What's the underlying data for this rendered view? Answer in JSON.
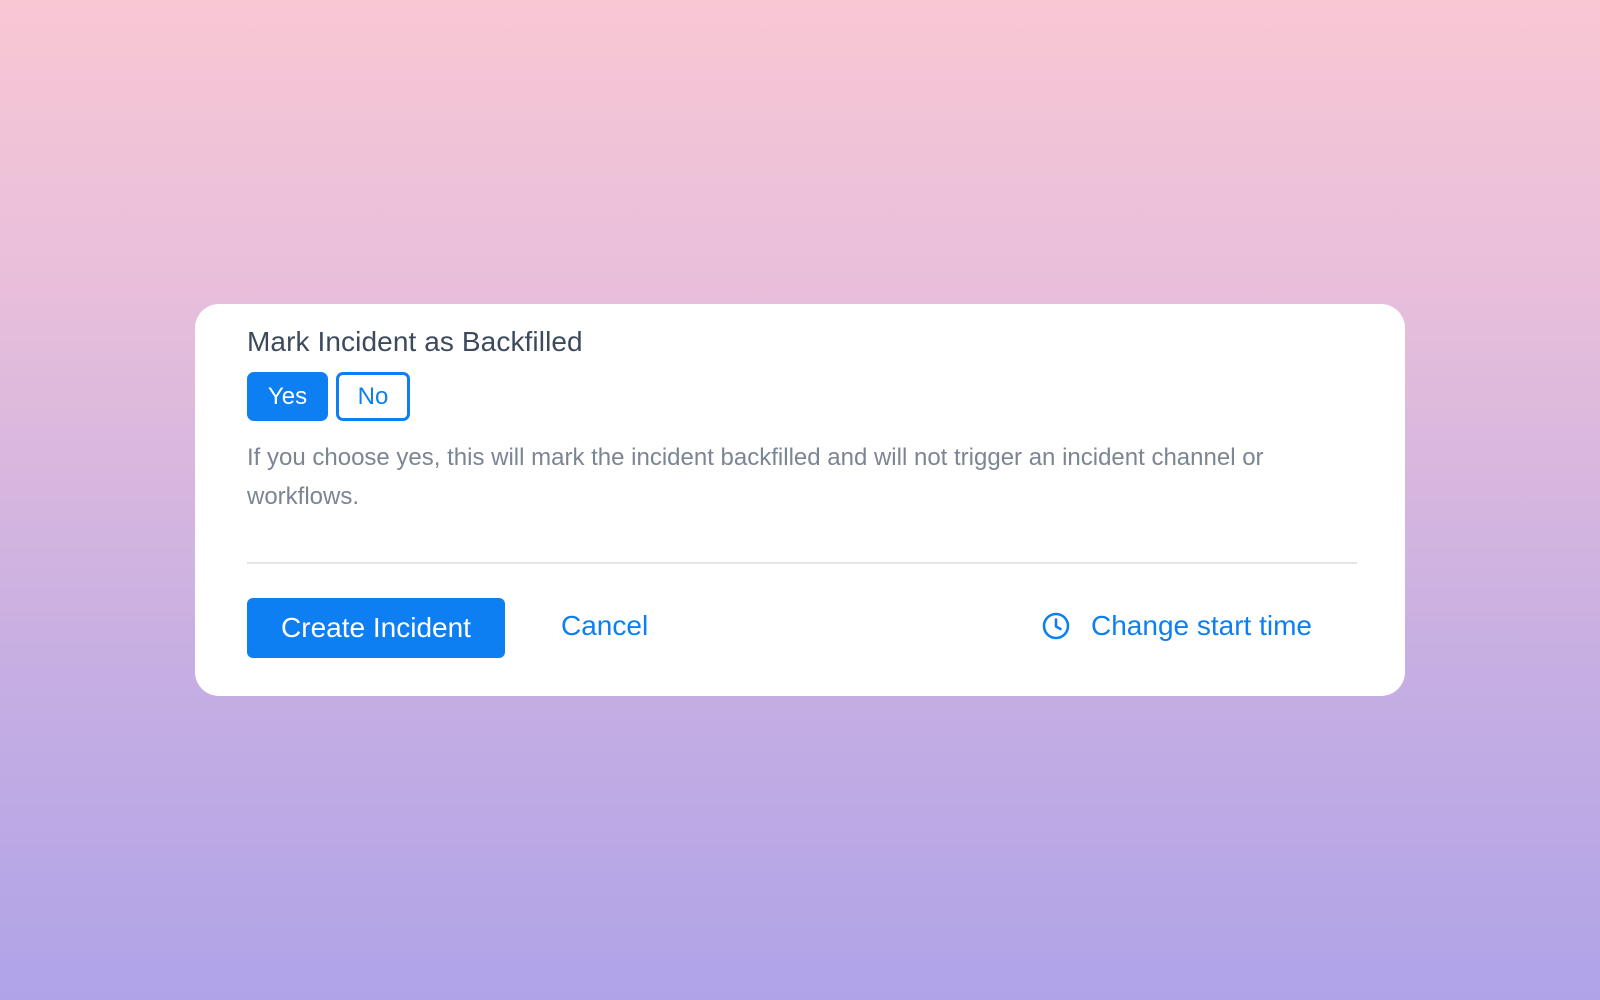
{
  "backfill": {
    "title": "Mark Incident as Backfilled",
    "options": [
      {
        "label": "Yes",
        "selected": true
      },
      {
        "label": "No",
        "selected": false
      }
    ],
    "description": "If you choose yes, this will mark the incident backfilled and will not trigger an incident channel or workflows."
  },
  "actions": {
    "create_label": "Create Incident",
    "cancel_label": "Cancel",
    "change_start_time_label": "Change start time",
    "change_start_time_icon": "clock-icon"
  },
  "colors": {
    "accent": "#0d7ff2",
    "title_text": "#3d4a5c",
    "muted_text": "#7b8593",
    "divider": "#e2e5ea"
  }
}
